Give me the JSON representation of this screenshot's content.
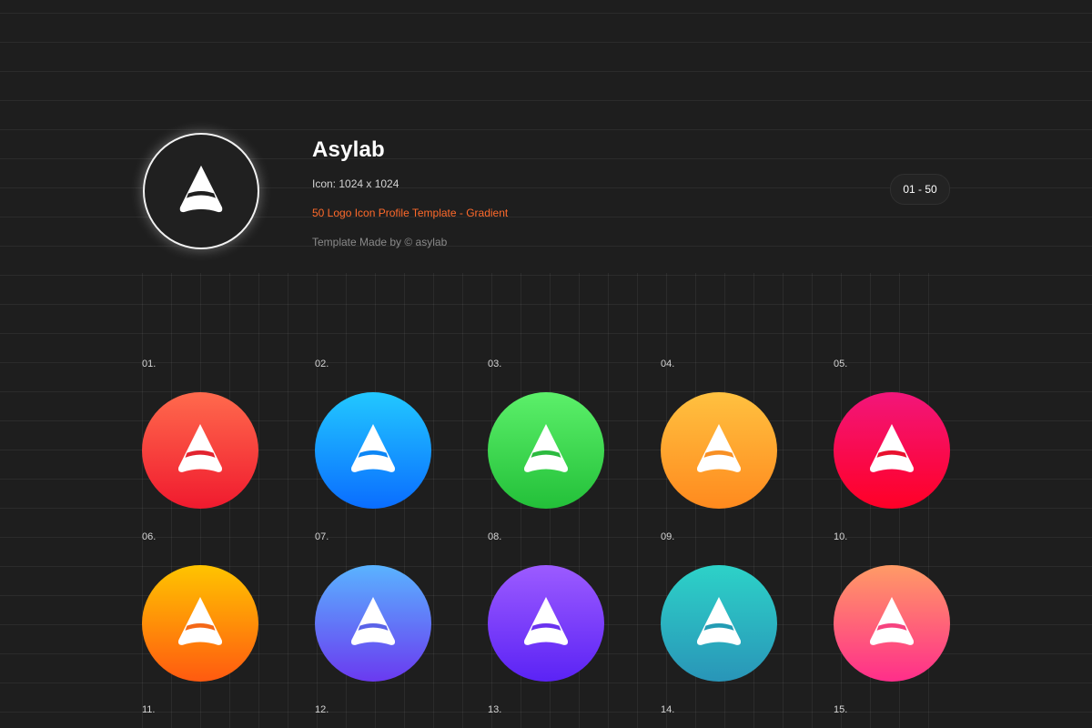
{
  "brand": {
    "name": "Asylab",
    "icon_size": "Icon: 1024 x 1024",
    "template_name": "50 Logo Icon Profile Template - Gradient",
    "credit": "Template Made by © asylab",
    "range": "01 - 50",
    "accent_color": "#ff6a2b",
    "logo_icon": "arrow-chevron-icon"
  },
  "icons": [
    {
      "label": "01.",
      "gradient": [
        "#ff6a4d",
        "#f01a2e"
      ],
      "stripe": "#e2232f"
    },
    {
      "label": "02.",
      "gradient": [
        "#22c8ff",
        "#0a6dff"
      ],
      "stripe": "#0d86f5"
    },
    {
      "label": "03.",
      "gradient": [
        "#5cf06a",
        "#23c039"
      ],
      "stripe": "#2cba3f"
    },
    {
      "label": "04.",
      "gradient": [
        "#ffc140",
        "#ff8a1e"
      ],
      "stripe": "#f89024"
    },
    {
      "label": "05.",
      "gradient": [
        "#f2167a",
        "#ff0026"
      ],
      "stripe": "#e8112e"
    },
    {
      "label": "06.",
      "gradient": [
        "#ffc400",
        "#ff5a10"
      ],
      "stripe": "#f46817"
    },
    {
      "label": "07.",
      "gradient": [
        "#5ab3ff",
        "#6a3af0"
      ],
      "stripe": "#5a63e8"
    },
    {
      "label": "08.",
      "gradient": [
        "#9c5bff",
        "#5b23f5"
      ],
      "stripe": "#6a33ef"
    },
    {
      "label": "09.",
      "gradient": [
        "#2dd2c8",
        "#2995b8"
      ],
      "stripe": "#239cb4"
    },
    {
      "label": "10.",
      "gradient": [
        "#ff9b66",
        "#ff2e8a"
      ],
      "stripe": "#f6437f"
    }
  ],
  "next_row_labels": [
    "11.",
    "12.",
    "13.",
    "14.",
    "15."
  ]
}
